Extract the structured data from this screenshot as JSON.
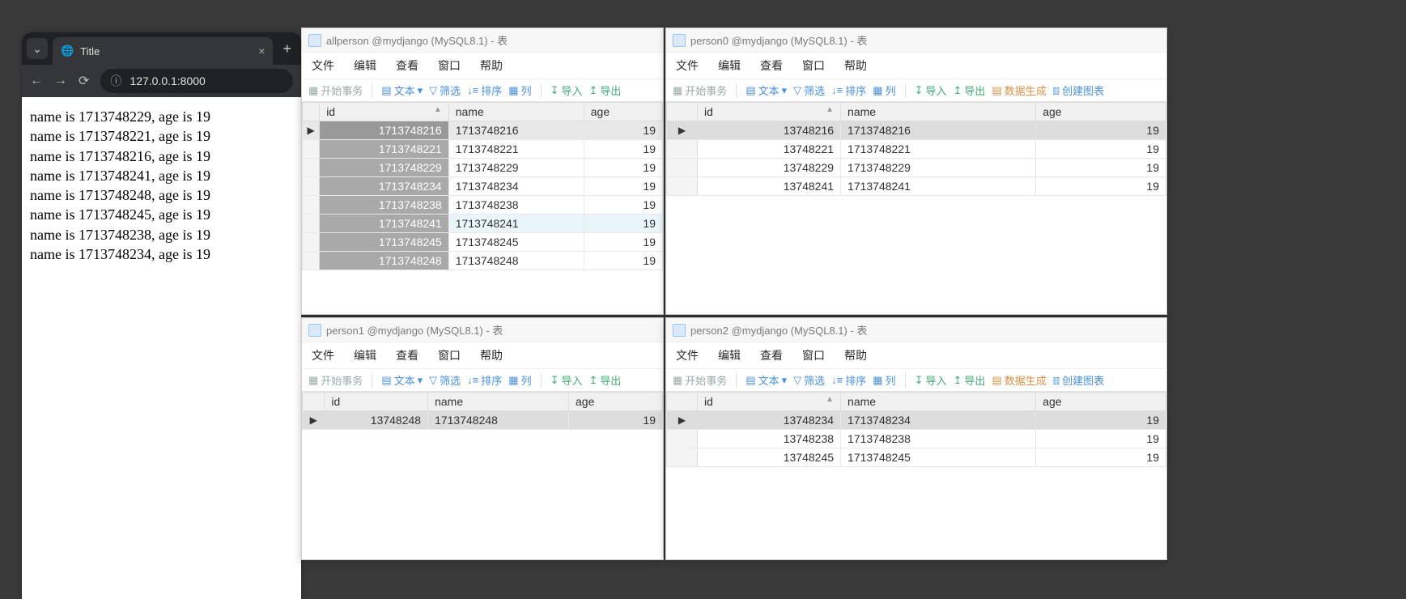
{
  "browser": {
    "tab_title": "Title",
    "url": "127.0.0.1:8000",
    "lines": [
      "name is 1713748229, age is 19",
      "name is 1713748221, age is 19",
      "name is 1713748216, age is 19",
      "name is 1713748241, age is 19",
      "name is 1713748248, age is 19",
      "name is 1713748245, age is 19",
      "name is 1713748238, age is 19",
      "name is 1713748234, age is 19"
    ]
  },
  "menus": {
    "file": "文件",
    "edit": "编辑",
    "view": "查看",
    "window": "窗口",
    "help": "帮助"
  },
  "toolbar": {
    "begin": "开始事务",
    "text": "文本",
    "filter": "筛选",
    "sort": "排序",
    "column": "列",
    "import": "导入",
    "export": "导出",
    "gen": "数据生成",
    "chart": "创建图表"
  },
  "cols": {
    "id": "id",
    "name": "name",
    "age": "age"
  },
  "windows": {
    "allperson": {
      "title": "allperson @mydjango (MySQL8.1) - 表",
      "rows": [
        {
          "id": "1713748216",
          "name": "1713748216",
          "age": "19",
          "mark": "▶",
          "sel": true
        },
        {
          "id": "1713748221",
          "name": "1713748221",
          "age": "19"
        },
        {
          "id": "1713748229",
          "name": "1713748229",
          "age": "19"
        },
        {
          "id": "1713748234",
          "name": "1713748234",
          "age": "19"
        },
        {
          "id": "1713748238",
          "name": "1713748238",
          "age": "19"
        },
        {
          "id": "1713748241",
          "name": "1713748241",
          "age": "19",
          "hl": true
        },
        {
          "id": "1713748245",
          "name": "1713748245",
          "age": "19"
        },
        {
          "id": "1713748248",
          "name": "1713748248",
          "age": "19"
        }
      ]
    },
    "person0": {
      "title": "person0 @mydjango (MySQL8.1) - 表",
      "rows": [
        {
          "id": "13748216",
          "name": "1713748216",
          "age": "19",
          "mark": "▶",
          "sel": true
        },
        {
          "id": "13748221",
          "name": "1713748221",
          "age": "19"
        },
        {
          "id": "13748229",
          "name": "1713748229",
          "age": "19"
        },
        {
          "id": "13748241",
          "name": "1713748241",
          "age": "19"
        }
      ]
    },
    "person1": {
      "title": "person1 @mydjango (MySQL8.1) - 表",
      "rows": [
        {
          "id": "13748248",
          "name": "1713748248",
          "age": "19",
          "mark": "▶",
          "sel": true
        }
      ]
    },
    "person2": {
      "title": "person2 @mydjango (MySQL8.1) - 表",
      "rows": [
        {
          "id": "13748234",
          "name": "1713748234",
          "age": "19",
          "mark": "▶",
          "sel": true
        },
        {
          "id": "13748238",
          "name": "1713748238",
          "age": "19"
        },
        {
          "id": "13748245",
          "name": "1713748245",
          "age": "19"
        }
      ]
    }
  }
}
